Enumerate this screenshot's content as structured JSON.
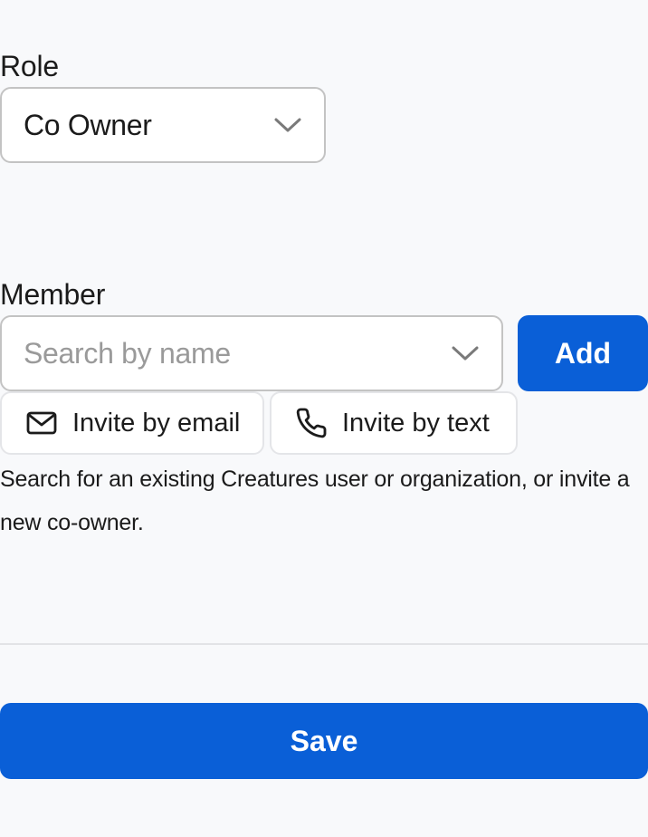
{
  "role": {
    "label": "Role",
    "selected_value": "Co Owner"
  },
  "member": {
    "label": "Member",
    "search_placeholder": "Search by name",
    "add_label": "Add",
    "invite_email_label": "Invite by email",
    "invite_text_label": "Invite by text",
    "help_text": "Search for an existing Creatures user or organization, or invite a new co-owner."
  },
  "footer": {
    "save_label": "Save"
  },
  "icons": {
    "role_dropdown": "chevron-down-icon",
    "member_dropdown": "chevron-down-icon",
    "invite_email": "mail-icon",
    "invite_text": "phone-icon"
  },
  "colors": {
    "background": "#f8f9fb",
    "primary": "#0a5fd7",
    "border": "#c3c3c3",
    "placeholder": "#9a9a9a",
    "text": "#1b1b1b"
  }
}
